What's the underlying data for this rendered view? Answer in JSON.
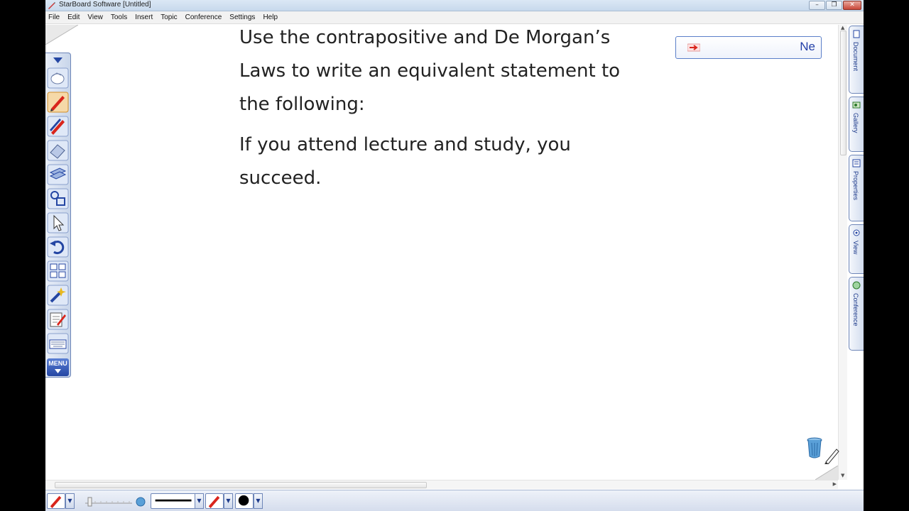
{
  "window": {
    "title": "StarBoard Software [Untitled]"
  },
  "menu": [
    "File",
    "Edit",
    "View",
    "Tools",
    "Insert",
    "Topic",
    "Conference",
    "Settings",
    "Help"
  ],
  "slide": {
    "lines": [
      "Use the contrapositive and De Morgan’s",
      "Laws to write an equivalent statement to",
      "the following:",
      "If you attend lecture and study, you",
      "succeed."
    ]
  },
  "name_box": {
    "text": "Ne"
  },
  "left_toolbar": {
    "tools": [
      "pointer-hand-icon",
      "pen-icon",
      "multi-pen-icon",
      "eraser-icon",
      "stacked-pages-icon",
      "shapes-icon",
      "select-arrow-icon",
      "undo-icon",
      "layout-icon",
      "magic-tool-icon",
      "edit-page-icon",
      "keyboard-icon"
    ],
    "menu_label": "MENU"
  },
  "side_tabs": [
    "Document",
    "Gallery",
    "Properties",
    "View",
    "Conference"
  ],
  "colors": {
    "accent": "#2446a3",
    "pen": "#d9251c",
    "tab_text": "#1d3a8a"
  }
}
